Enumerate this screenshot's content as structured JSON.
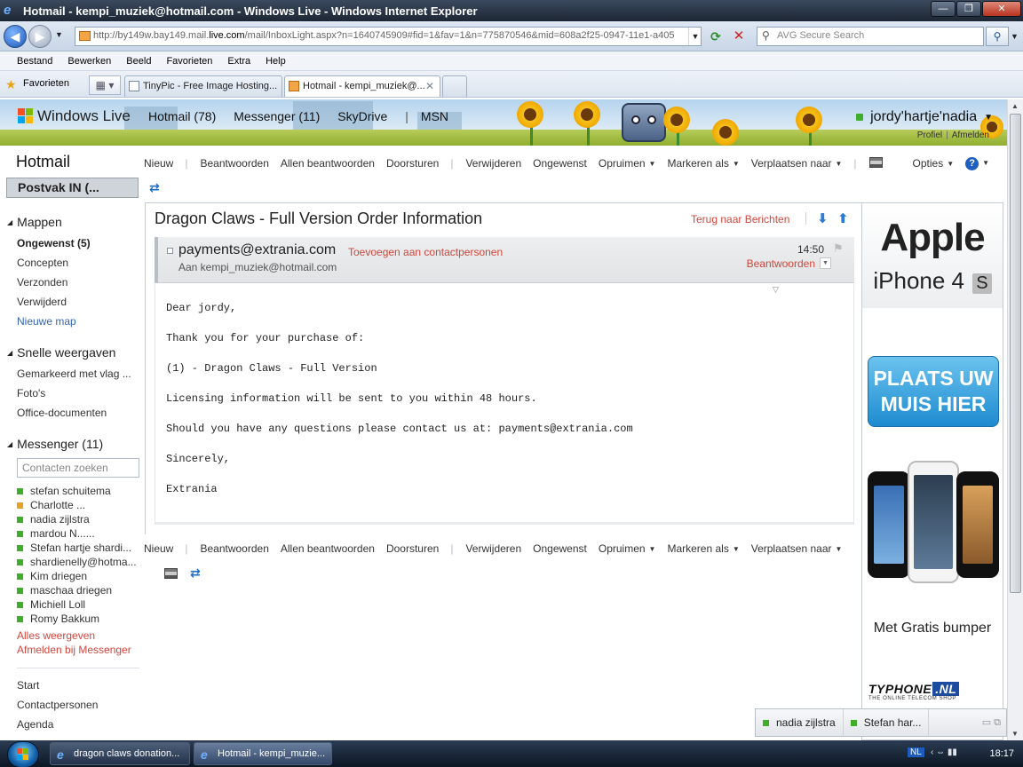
{
  "window": {
    "title": "Hotmail - kempi_muziek@hotmail.com - Windows Live - Windows Internet Explorer",
    "buttons": {
      "minimize": "—",
      "maximize": "❐",
      "close": "✕"
    }
  },
  "address": {
    "url_prefix": "http://by149w.bay149.mail.",
    "url_host": "live.com",
    "url_rest": "/mail/InboxLight.aspx?n=1640745909#fid=1&fav=1&n=775870546&mid=608a2f25-0947-11e1-a405",
    "search_placeholder": "AVG Secure Search"
  },
  "menubar": [
    "Bestand",
    "Bewerken",
    "Beeld",
    "Favorieten",
    "Extra",
    "Help"
  ],
  "favorites_label": "Favorieten",
  "tabs": [
    {
      "label": "TinyPic - Free Image Hosting..."
    },
    {
      "label": "Hotmail - kempi_muziek@..."
    }
  ],
  "wl": {
    "logo": "Windows Live",
    "nav": [
      "Hotmail (78)",
      "Messenger (11)",
      "SkyDrive",
      "MSN"
    ],
    "user": "jordy'hartje'nadia",
    "profile": "Profiel",
    "signout": "Afmelden"
  },
  "left": {
    "brand": "Hotmail",
    "inbox": "Postvak IN (...",
    "folders_header": "Mappen",
    "folders": [
      {
        "label": "Ongewenst (5)",
        "style": "bold"
      },
      {
        "label": "Concepten",
        "style": "normal"
      },
      {
        "label": "Verzonden",
        "style": "normal"
      },
      {
        "label": "Verwijderd",
        "style": "normal"
      },
      {
        "label": "Nieuwe map",
        "style": "blue"
      }
    ],
    "quickviews_header": "Snelle weergaven",
    "quickviews": [
      "Gemarkeerd met vlag ...",
      "Foto's",
      "Office-documenten"
    ],
    "messenger_header": "Messenger (11)",
    "contact_search_placeholder": "Contacten zoeken",
    "contacts": [
      {
        "name": "stefan schuitema",
        "status": "online"
      },
      {
        "name": "Charlotte ...",
        "status": "away"
      },
      {
        "name": "nadia zijlstra",
        "status": "online"
      },
      {
        "name": "mardou N......",
        "status": "online"
      },
      {
        "name": "Stefan hartje shardi...",
        "status": "online"
      },
      {
        "name": "shardienelly@hotma...",
        "status": "online"
      },
      {
        "name": "Kim driegen",
        "status": "online"
      },
      {
        "name": "maschaa driegen",
        "status": "online"
      },
      {
        "name": "Michiell Loll",
        "status": "online"
      },
      {
        "name": "Romy Bakkum",
        "status": "online"
      }
    ],
    "show_all": "Alles weergeven",
    "messenger_signout": "Afmelden bij Messenger",
    "bottom_links": [
      "Start",
      "Contactpersonen",
      "Agenda"
    ]
  },
  "toolbar": {
    "new": "Nieuw",
    "reply": "Beantwoorden",
    "reply_all": "Allen beantwoorden",
    "forward": "Doorsturen",
    "delete": "Verwijderen",
    "junk": "Ongewenst",
    "sweep": "Opruimen",
    "mark_as": "Markeren als",
    "move_to": "Verplaatsen naar",
    "options": "Opties"
  },
  "message": {
    "subject": "Dragon Claws - Full Version Order Information",
    "back_link": "Terug naar Berichten",
    "from": "payments@extrania.com",
    "add_contact": "Toevoegen aan contactpersonen",
    "to": "Aan kempi_muziek@hotmail.com",
    "time": "14:50",
    "reply": "Beantwoorden",
    "body": [
      "Dear jordy,",
      "Thank you for your purchase of:",
      "(1) - Dragon Claws - Full Version",
      "Licensing information will be sent to you within 48 hours.",
      "Should you have any questions please contact us at: payments@extrania.com",
      "Sincerely,",
      "Extrania"
    ]
  },
  "ads": {
    "apple": "Apple",
    "iphone": "iPhone 4",
    "iphone_s": "S",
    "plaats_line1": "PLAATS UW",
    "plaats_line2": "MUIS HIER",
    "bumper": "Met Gratis bumper",
    "typhone": "TYPHONE",
    "typhone_nl": ".NL",
    "typhone_tag": "THE ONLINE TELECOM SHOP"
  },
  "chatbar": [
    "nadia zijlstra",
    "Stefan har..."
  ],
  "taskbar": {
    "tasks": [
      "dragon claws donation...",
      "Hotmail - kempi_muzie..."
    ],
    "lang": "NL",
    "clock": "18:17"
  },
  "colors": {
    "accent_red": "#d0463c",
    "link_blue": "#3566b2",
    "online": "#3fae2a",
    "away": "#e6a226"
  }
}
